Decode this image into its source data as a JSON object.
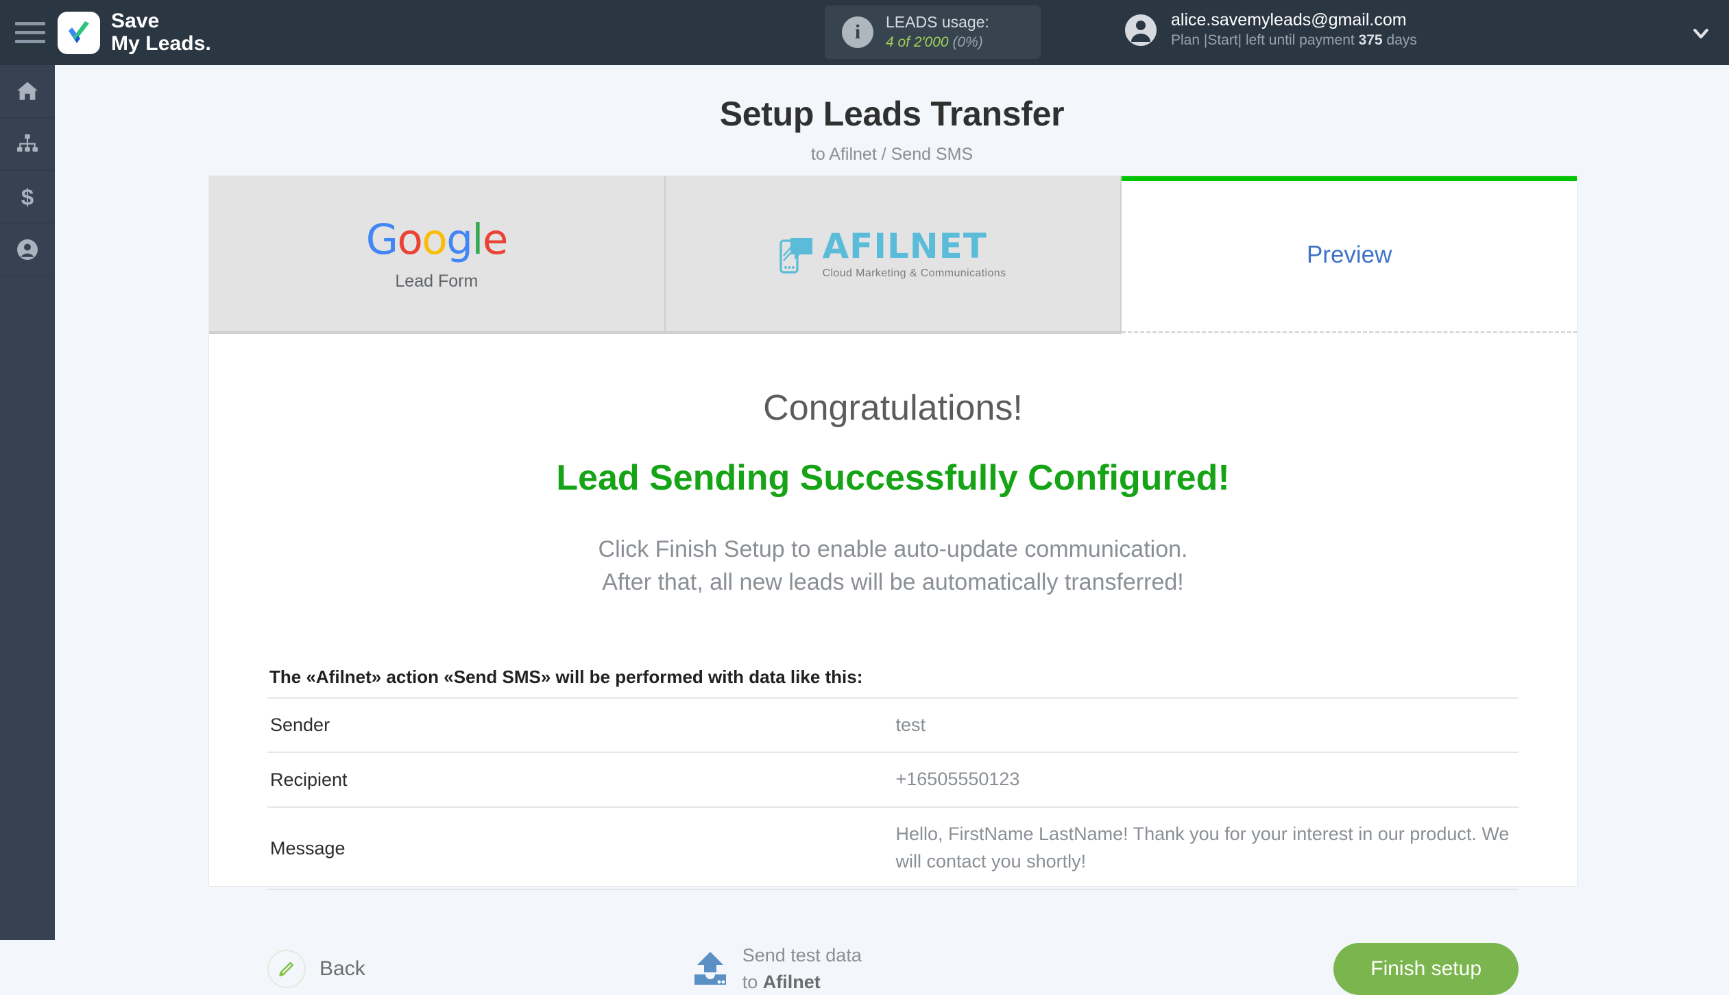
{
  "header": {
    "brand_line1": "Save",
    "brand_line2": "My Leads.",
    "usage_label": "LEADS usage:",
    "usage_value": "4 of 2'000",
    "usage_percent": "(0%)",
    "account_email": "alice.savemyleads@gmail.com",
    "plan_prefix": "Plan |Start| left until payment",
    "plan_days": "375",
    "plan_suffix": "days"
  },
  "sidebar": {
    "items": [
      {
        "name": "home",
        "label": "Home"
      },
      {
        "name": "connections",
        "label": "Connections"
      },
      {
        "name": "billing",
        "label": "Billing"
      },
      {
        "name": "profile",
        "label": "Profile"
      }
    ]
  },
  "page": {
    "title": "Setup Leads Transfer",
    "subtitle": "to Afilnet / Send SMS"
  },
  "tabs": [
    {
      "id": "source",
      "logo": "google",
      "logo_text": "Google",
      "caption": "Lead Form",
      "state": "inactive"
    },
    {
      "id": "destination",
      "logo": "afilnet",
      "logo_text": "AFILNET",
      "caption": "Cloud Marketing & Communications",
      "state": "inactive"
    },
    {
      "id": "preview",
      "logo": "none",
      "logo_text": "Preview",
      "caption": "",
      "state": "active"
    }
  ],
  "main": {
    "congrats": "Congratulations!",
    "success": "Lead Sending Successfully Configured!",
    "desc_line1": "Click Finish Setup to enable auto-update communication.",
    "desc_line2": "After that, all new leads will be automatically transferred!"
  },
  "preview_table": {
    "caption": "The «Afilnet» action «Send SMS» will be performed with data like this:",
    "rows": [
      {
        "key": "Sender",
        "value": "test"
      },
      {
        "key": "Recipient",
        "value": "+16505550123"
      },
      {
        "key": "Message",
        "value": "Hello, FirstName LastName! Thank you for your interest in our product. We will contact you shortly!"
      }
    ]
  },
  "footer": {
    "back_label": "Back",
    "send_test_line1": "Send test data",
    "send_test_to": "to",
    "send_test_target": "Afilnet",
    "finish_label": "Finish setup"
  },
  "colors": {
    "header_bg": "#2b3643",
    "sidebar_bg": "#364152",
    "page_bg": "#f3f6fa",
    "accent_green": "#00c400",
    "success_green": "#16a416",
    "button_green": "#7ab64d",
    "link_blue": "#3d74c7",
    "afilnet_blue": "#5bbcd9"
  }
}
